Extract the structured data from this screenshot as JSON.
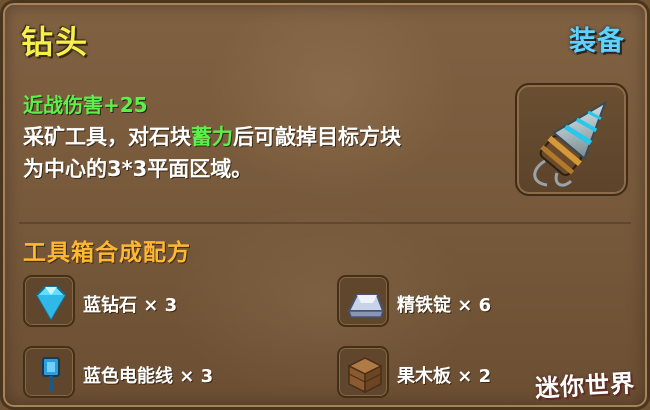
{
  "item": {
    "name": "钻头",
    "equip_label": "装备",
    "melee_damage": "近战伤害+25",
    "desc_part1": "采矿工具，对石块",
    "desc_highlight": "蓄力",
    "desc_part2": "后可敲掉目标方块",
    "desc_line2": "为中心的3*3平面区域。",
    "icon": "drill-icon"
  },
  "recipe": {
    "title": "工具箱合成配方",
    "ingredients": [
      {
        "name": "蓝钻石 × 3",
        "icon": "blue-diamond-icon"
      },
      {
        "name": "精铁锭 × 6",
        "icon": "iron-ingot-icon"
      },
      {
        "name": "蓝色电能线 × 3",
        "icon": "blue-wire-icon"
      },
      {
        "name": "果木板 × 2",
        "icon": "wood-plank-icon"
      }
    ]
  },
  "logo": "迷你世界",
  "colors": {
    "title": "#f6f04a",
    "equip": "#5fd3ff",
    "highlight": "#5ef04a",
    "recipe_title": "#ffb830",
    "panel_bg": "#7a5c3c"
  }
}
